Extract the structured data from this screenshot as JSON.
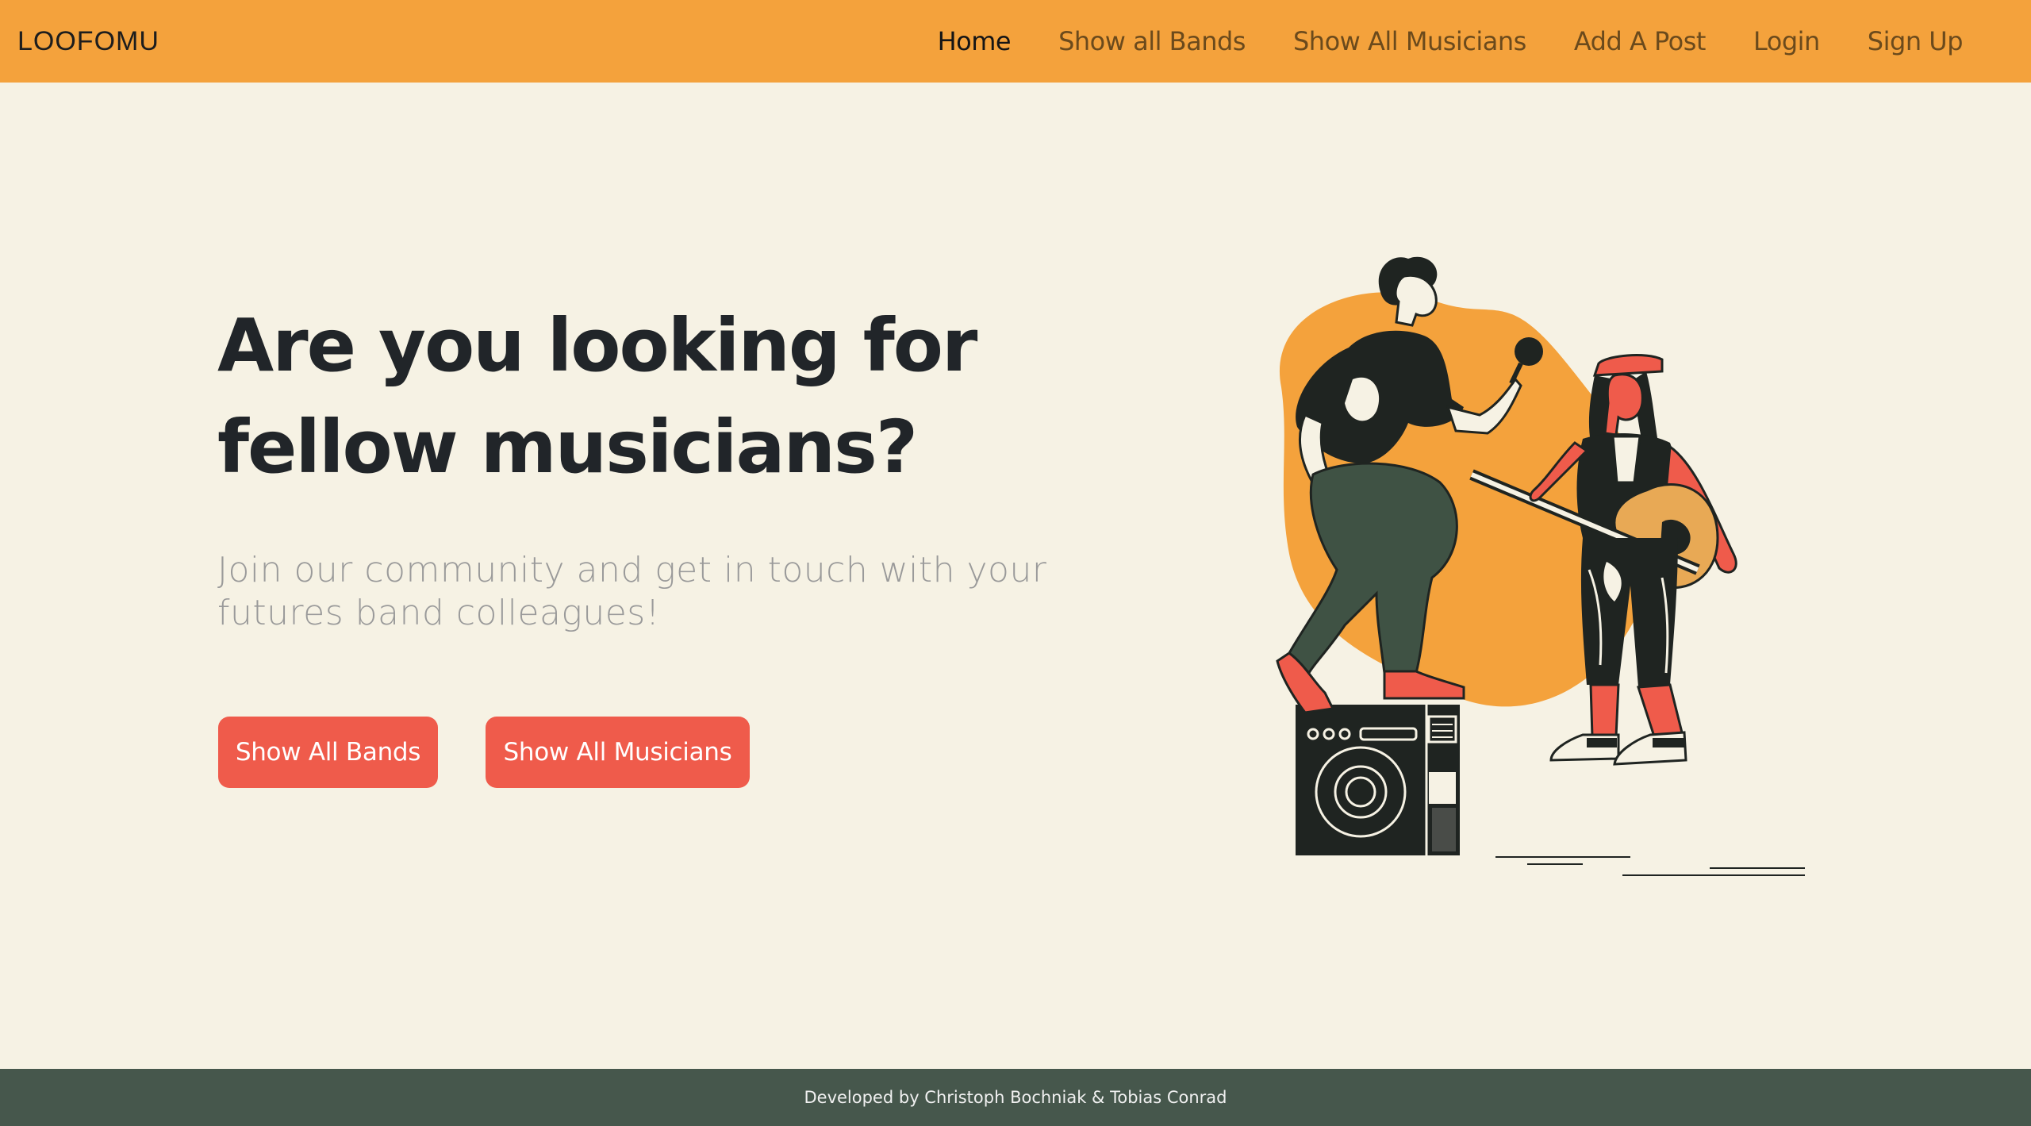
{
  "navbar": {
    "brand": "LOOFOMU",
    "links": [
      {
        "label": "Home",
        "active": true
      },
      {
        "label": "Show all Bands"
      },
      {
        "label": "Show All Musicians"
      },
      {
        "label": "Add A Post"
      },
      {
        "label": "Login"
      },
      {
        "label": "Sign Up"
      }
    ]
  },
  "hero": {
    "title_line1": "Are you looking for",
    "title_line2": "fellow musicians?",
    "subtitle": "Join our community and get in touch with your futures band colleagues!",
    "buttons": {
      "bands": "Show All Bands",
      "musicians": "Show All Musicians"
    },
    "illustration": "musicians-illustration"
  },
  "footer": {
    "text": "Developed by Christoph Bochniak & Tobias Conrad"
  },
  "colors": {
    "navbar": "#f4a23c",
    "background": "#f6f2e4",
    "button": "#ef5b4b",
    "footer": "#46574c",
    "title": "#212529",
    "subtitle": "#9a9a9a"
  }
}
